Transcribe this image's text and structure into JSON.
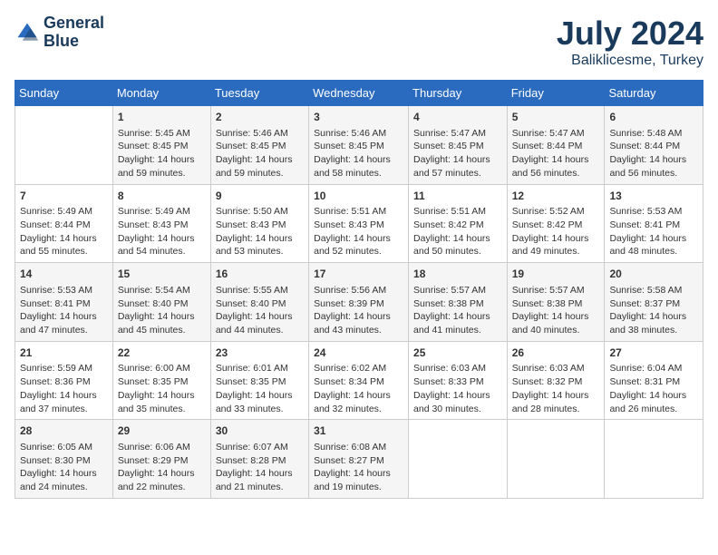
{
  "header": {
    "logo_line1": "General",
    "logo_line2": "Blue",
    "month": "July 2024",
    "location": "Baliklicesme, Turkey"
  },
  "days_of_week": [
    "Sunday",
    "Monday",
    "Tuesday",
    "Wednesday",
    "Thursday",
    "Friday",
    "Saturday"
  ],
  "weeks": [
    [
      {
        "day": "",
        "content": ""
      },
      {
        "day": "1",
        "content": "Sunrise: 5:45 AM\nSunset: 8:45 PM\nDaylight: 14 hours\nand 59 minutes."
      },
      {
        "day": "2",
        "content": "Sunrise: 5:46 AM\nSunset: 8:45 PM\nDaylight: 14 hours\nand 59 minutes."
      },
      {
        "day": "3",
        "content": "Sunrise: 5:46 AM\nSunset: 8:45 PM\nDaylight: 14 hours\nand 58 minutes."
      },
      {
        "day": "4",
        "content": "Sunrise: 5:47 AM\nSunset: 8:45 PM\nDaylight: 14 hours\nand 57 minutes."
      },
      {
        "day": "5",
        "content": "Sunrise: 5:47 AM\nSunset: 8:44 PM\nDaylight: 14 hours\nand 56 minutes."
      },
      {
        "day": "6",
        "content": "Sunrise: 5:48 AM\nSunset: 8:44 PM\nDaylight: 14 hours\nand 56 minutes."
      }
    ],
    [
      {
        "day": "7",
        "content": "Sunrise: 5:49 AM\nSunset: 8:44 PM\nDaylight: 14 hours\nand 55 minutes."
      },
      {
        "day": "8",
        "content": "Sunrise: 5:49 AM\nSunset: 8:43 PM\nDaylight: 14 hours\nand 54 minutes."
      },
      {
        "day": "9",
        "content": "Sunrise: 5:50 AM\nSunset: 8:43 PM\nDaylight: 14 hours\nand 53 minutes."
      },
      {
        "day": "10",
        "content": "Sunrise: 5:51 AM\nSunset: 8:43 PM\nDaylight: 14 hours\nand 52 minutes."
      },
      {
        "day": "11",
        "content": "Sunrise: 5:51 AM\nSunset: 8:42 PM\nDaylight: 14 hours\nand 50 minutes."
      },
      {
        "day": "12",
        "content": "Sunrise: 5:52 AM\nSunset: 8:42 PM\nDaylight: 14 hours\nand 49 minutes."
      },
      {
        "day": "13",
        "content": "Sunrise: 5:53 AM\nSunset: 8:41 PM\nDaylight: 14 hours\nand 48 minutes."
      }
    ],
    [
      {
        "day": "14",
        "content": "Sunrise: 5:53 AM\nSunset: 8:41 PM\nDaylight: 14 hours\nand 47 minutes."
      },
      {
        "day": "15",
        "content": "Sunrise: 5:54 AM\nSunset: 8:40 PM\nDaylight: 14 hours\nand 45 minutes."
      },
      {
        "day": "16",
        "content": "Sunrise: 5:55 AM\nSunset: 8:40 PM\nDaylight: 14 hours\nand 44 minutes."
      },
      {
        "day": "17",
        "content": "Sunrise: 5:56 AM\nSunset: 8:39 PM\nDaylight: 14 hours\nand 43 minutes."
      },
      {
        "day": "18",
        "content": "Sunrise: 5:57 AM\nSunset: 8:38 PM\nDaylight: 14 hours\nand 41 minutes."
      },
      {
        "day": "19",
        "content": "Sunrise: 5:57 AM\nSunset: 8:38 PM\nDaylight: 14 hours\nand 40 minutes."
      },
      {
        "day": "20",
        "content": "Sunrise: 5:58 AM\nSunset: 8:37 PM\nDaylight: 14 hours\nand 38 minutes."
      }
    ],
    [
      {
        "day": "21",
        "content": "Sunrise: 5:59 AM\nSunset: 8:36 PM\nDaylight: 14 hours\nand 37 minutes."
      },
      {
        "day": "22",
        "content": "Sunrise: 6:00 AM\nSunset: 8:35 PM\nDaylight: 14 hours\nand 35 minutes."
      },
      {
        "day": "23",
        "content": "Sunrise: 6:01 AM\nSunset: 8:35 PM\nDaylight: 14 hours\nand 33 minutes."
      },
      {
        "day": "24",
        "content": "Sunrise: 6:02 AM\nSunset: 8:34 PM\nDaylight: 14 hours\nand 32 minutes."
      },
      {
        "day": "25",
        "content": "Sunrise: 6:03 AM\nSunset: 8:33 PM\nDaylight: 14 hours\nand 30 minutes."
      },
      {
        "day": "26",
        "content": "Sunrise: 6:03 AM\nSunset: 8:32 PM\nDaylight: 14 hours\nand 28 minutes."
      },
      {
        "day": "27",
        "content": "Sunrise: 6:04 AM\nSunset: 8:31 PM\nDaylight: 14 hours\nand 26 minutes."
      }
    ],
    [
      {
        "day": "28",
        "content": "Sunrise: 6:05 AM\nSunset: 8:30 PM\nDaylight: 14 hours\nand 24 minutes."
      },
      {
        "day": "29",
        "content": "Sunrise: 6:06 AM\nSunset: 8:29 PM\nDaylight: 14 hours\nand 22 minutes."
      },
      {
        "day": "30",
        "content": "Sunrise: 6:07 AM\nSunset: 8:28 PM\nDaylight: 14 hours\nand 21 minutes."
      },
      {
        "day": "31",
        "content": "Sunrise: 6:08 AM\nSunset: 8:27 PM\nDaylight: 14 hours\nand 19 minutes."
      },
      {
        "day": "",
        "content": ""
      },
      {
        "day": "",
        "content": ""
      },
      {
        "day": "",
        "content": ""
      }
    ]
  ]
}
